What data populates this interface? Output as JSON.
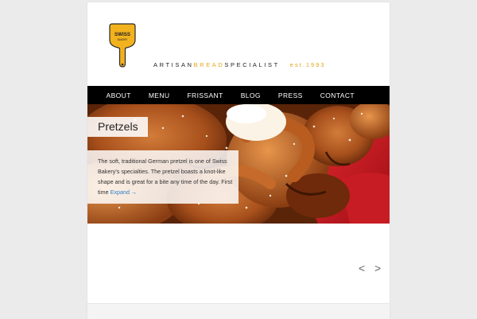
{
  "brand": {
    "logo_text_line1": "SWISS",
    "logo_text_line2": "BAKERY",
    "tagline_artisan": "ARTISAN",
    "tagline_bread": "BREAD",
    "tagline_specialist": "SPECIALIST",
    "tagline_est": "est.1993",
    "accent_color": "#e0a817"
  },
  "nav": {
    "items": [
      {
        "label": "ABOUT"
      },
      {
        "label": "MENU"
      },
      {
        "label": "FRISSANT"
      },
      {
        "label": "BLOG"
      },
      {
        "label": "PRESS"
      },
      {
        "label": "CONTACT"
      }
    ]
  },
  "slide": {
    "title": "Pretzels",
    "caption": "The soft, traditional German pretzel is one of Swiss Bakery's specialties. The pretzel boasts a knot-like shape and is great for a bite any time of the day. First time ",
    "expand_label": "Expand →"
  },
  "slider": {
    "prev_icon": "chevron-left-icon",
    "prev_glyph": "<",
    "next_icon": "chevron-right-icon",
    "next_glyph": ">"
  }
}
